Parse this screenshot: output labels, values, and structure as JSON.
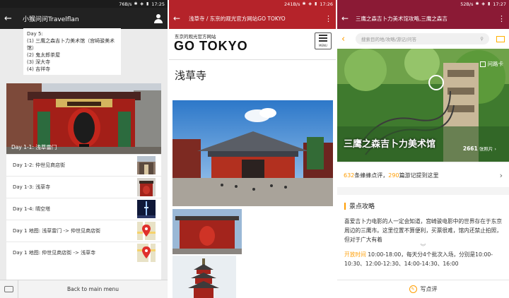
{
  "phone1": {
    "status": {
      "speed": "76B/s",
      "time": "17:25"
    },
    "title": "小猴问问Travelflan",
    "message_lines": [
      "Day 5:",
      "(1) 三鹰之森吉卜力美术馆（宫崎骏美术馆）",
      "(2) 鬼太郎茶屋",
      "(3) 深大寺",
      "(4) 吉祥寺"
    ],
    "hero_caption": "Day 1-1: 浅草雷门",
    "items": [
      {
        "label": "Day 1-2: 仲世见商店街"
      },
      {
        "label": "Day 1-3: 浅草寺"
      },
      {
        "label": "Day 1-4: 晴空塔"
      },
      {
        "label": "Day 1 地图: 浅草雷门 -> 仲世见商店街"
      },
      {
        "label": "Day 1 地图: 仲世见商店街 -> 浅草寺"
      }
    ],
    "bottom_menu": "Back to main menu"
  },
  "phone2": {
    "status": {
      "speed": "241B/s",
      "time": "17:26"
    },
    "title": "浅草寺 / 东京的观光官方网站GO TOKYO",
    "subtitle": "东京的观光官方网站",
    "logo": "GO TOKYO",
    "menu_label": "MENU",
    "heading": "浅草寺"
  },
  "phone3": {
    "status": {
      "speed": "52B/s",
      "time": "17:27"
    },
    "title": "三鹰之森吉卜力美术馆攻略,三鹰之森吉",
    "search_placeholder": "搜索目的地/攻略/游记/问答",
    "hero_card": "问路卡",
    "hero_title": "三鹰之森吉卜力美术馆",
    "photo_count": "2661",
    "photo_label": "张照片",
    "review_count": "632",
    "review_text": "条蜂蜂点评，",
    "note_count": "290",
    "note_text": "篇游记提到这里",
    "section_title": "景点攻略",
    "description": "喜爱吉卜力电影的人一定会知道，宫崎骏电影中的世界存在于东京周边的三鹰市。这里位置不算便利，买票很难，馆内还禁止拍照，但对于广大有着",
    "hours_label": "开放时间",
    "hours_text": "10:00-18:00，每天分4个批次入场，分别是10:00-10:30、12:00-12:30、14:00-14:30、16:00",
    "write_review": "写点评",
    "colors": {
      "accent": "#ff9d00",
      "appbar": "#8b1a35"
    }
  }
}
